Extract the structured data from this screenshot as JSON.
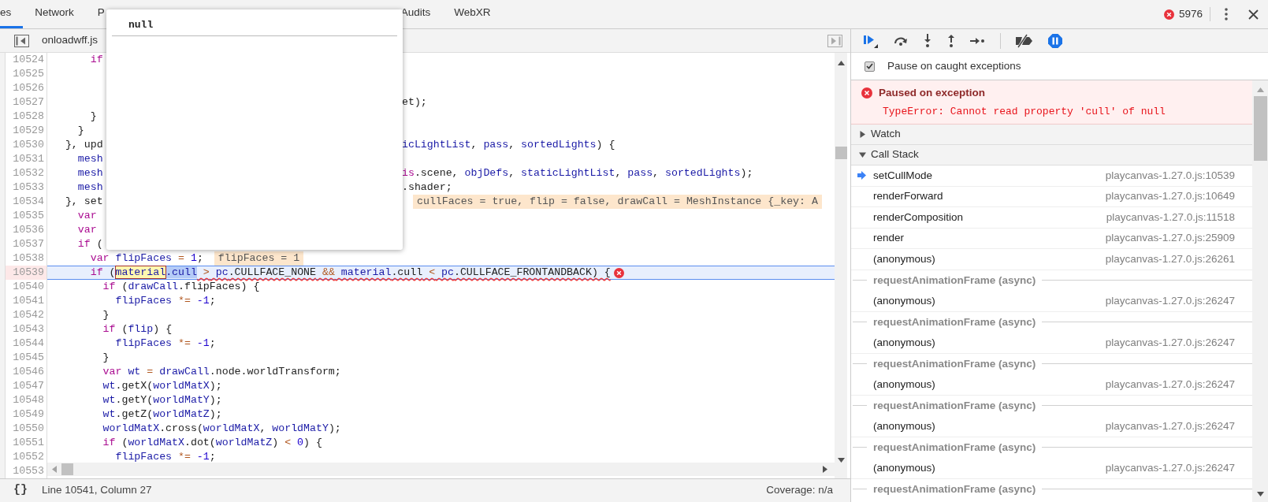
{
  "tabs": [
    {
      "label": "es",
      "selected": true
    },
    {
      "label": "Network",
      "selected": false
    },
    {
      "label": "P",
      "selected": false
    },
    {
      "label": "Audits",
      "selected": false
    },
    {
      "label": "WebXR",
      "selected": false
    }
  ],
  "error_count": "5976",
  "editor": {
    "file_tab": "onloadwff.js",
    "popover": {
      "value": "null"
    },
    "lines": [
      {
        "number": "10524",
        "paused": false,
        "tokens": [
          {
            "kw": "      if"
          }
        ]
      },
      {
        "number": "10525",
        "paused": false
      },
      {
        "number": "10526",
        "paused": false
      },
      {
        "number": "10527",
        "paused": false,
        "right": [
          {
            "plain": "et);"
          }
        ]
      },
      {
        "number": "10528",
        "paused": false,
        "tokens": [
          {
            "plain": "      }"
          }
        ]
      },
      {
        "number": "10529",
        "paused": false,
        "tokens": [
          {
            "plain": "    }"
          }
        ]
      },
      {
        "number": "10530",
        "paused": false,
        "tokens": [
          {
            "plain": "  }, upd"
          }
        ],
        "right": [
          {
            "var": "icLightList"
          },
          {
            "plain": ", "
          },
          {
            "var": "pass"
          },
          {
            "plain": ", "
          },
          {
            "var": "sortedLights"
          },
          {
            "plain": ") {"
          }
        ]
      },
      {
        "number": "10531",
        "paused": false,
        "tokens": [
          {
            "var": "    mesh"
          }
        ]
      },
      {
        "number": "10532",
        "paused": false,
        "tokens": [
          {
            "var": "    mesh"
          }
        ],
        "right": [
          {
            "kw": "is"
          },
          {
            "plain": ".scene, "
          },
          {
            "var": "objDefs"
          },
          {
            "plain": ", "
          },
          {
            "var": "staticLightList"
          },
          {
            "plain": ", "
          },
          {
            "var": "pass"
          },
          {
            "plain": ", "
          },
          {
            "var": "sortedLights"
          },
          {
            "plain": ");"
          }
        ]
      },
      {
        "number": "10533",
        "paused": false,
        "tokens": [
          {
            "var": "    mesh"
          }
        ],
        "right": [
          {
            "plain": ".shader;"
          }
        ]
      },
      {
        "number": "10534",
        "paused": false,
        "tokens": [
          {
            "plain": "  }, set"
          }
        ],
        "right": [
          {
            "inline": "cullFaces = true, flip = false, drawCall = MeshInstance {_key: A"
          }
        ]
      },
      {
        "number": "10535",
        "paused": false,
        "tokens": [
          {
            "kw": "    var"
          }
        ]
      },
      {
        "number": "10536",
        "paused": false,
        "tokens": [
          {
            "kw": "    var"
          }
        ]
      },
      {
        "number": "10537",
        "paused": false,
        "tokens": [
          {
            "kw": "    if"
          },
          {
            "plain": " ("
          }
        ]
      },
      {
        "number": "10538",
        "paused": false,
        "tokens": [
          {
            "kw": "      var"
          },
          {
            "var": " flipFaces"
          },
          {
            "op": " ="
          },
          {
            "num": " 1"
          },
          {
            "plain": ";"
          },
          {
            "inline": "flipFaces = 1"
          }
        ]
      },
      {
        "number": "10539",
        "paused": true,
        "tokens": [
          {
            "kw": "      if"
          },
          {
            "plain": " ("
          },
          {
            "hover": "material"
          },
          {
            "sel": ".cull"
          }
        ],
        "error_tokens": [
          {
            "op": " >"
          },
          {
            "var": " pc"
          },
          {
            "plain": ".CULLFACE_NONE"
          },
          {
            "op": " &&"
          },
          {
            "var": " material"
          },
          {
            "plain": ".cull"
          },
          {
            "op": " <"
          },
          {
            "var": " pc"
          },
          {
            "plain": ".CULLFACE_FRONTANDBACK) {"
          }
        ]
      },
      {
        "number": "10540",
        "paused": false,
        "tokens": [
          {
            "kw": "        if"
          },
          {
            "plain": " ("
          },
          {
            "var": "drawCall"
          },
          {
            "plain": ".flipFaces) {"
          }
        ]
      },
      {
        "number": "10541",
        "paused": false,
        "tokens": [
          {
            "var": "          flipFaces"
          },
          {
            "op": " *="
          },
          {
            "num": " -1"
          },
          {
            "plain": ";"
          }
        ]
      },
      {
        "number": "10542",
        "paused": false,
        "tokens": [
          {
            "plain": "        }"
          }
        ]
      },
      {
        "number": "10543",
        "paused": false,
        "tokens": [
          {
            "kw": "        if"
          },
          {
            "plain": " ("
          },
          {
            "var": "flip"
          },
          {
            "plain": ") {"
          }
        ]
      },
      {
        "number": "10544",
        "paused": false,
        "tokens": [
          {
            "var": "          flipFaces"
          },
          {
            "op": " *="
          },
          {
            "num": " -1"
          },
          {
            "plain": ";"
          }
        ]
      },
      {
        "number": "10545",
        "paused": false,
        "tokens": [
          {
            "plain": "        }"
          }
        ]
      },
      {
        "number": "10546",
        "paused": false,
        "tokens": [
          {
            "kw": "        var"
          },
          {
            "var": " wt"
          },
          {
            "op": " ="
          },
          {
            "var": " drawCall"
          },
          {
            "plain": ".node.worldTransform;"
          }
        ]
      },
      {
        "number": "10547",
        "paused": false,
        "tokens": [
          {
            "var": "        wt"
          },
          {
            "plain": ".getX("
          },
          {
            "var": "worldMatX"
          },
          {
            "plain": ");"
          }
        ]
      },
      {
        "number": "10548",
        "paused": false,
        "tokens": [
          {
            "var": "        wt"
          },
          {
            "plain": ".getY("
          },
          {
            "var": "worldMatY"
          },
          {
            "plain": ");"
          }
        ]
      },
      {
        "number": "10549",
        "paused": false,
        "tokens": [
          {
            "var": "        wt"
          },
          {
            "plain": ".getZ("
          },
          {
            "var": "worldMatZ"
          },
          {
            "plain": ");"
          }
        ]
      },
      {
        "number": "10550",
        "paused": false,
        "tokens": [
          {
            "var": "        worldMatX"
          },
          {
            "plain": ".cross("
          },
          {
            "var": "worldMatX"
          },
          {
            "plain": ", "
          },
          {
            "var": "worldMatY"
          },
          {
            "plain": ");"
          }
        ]
      },
      {
        "number": "10551",
        "paused": false,
        "tokens": [
          {
            "kw": "        if"
          },
          {
            "plain": " ("
          },
          {
            "var": "worldMatX"
          },
          {
            "plain": ".dot("
          },
          {
            "var": "worldMatZ"
          },
          {
            "plain": ")"
          },
          {
            "op": " <"
          },
          {
            "num": " 0"
          },
          {
            "plain": ") {"
          }
        ]
      },
      {
        "number": "10552",
        "paused": false,
        "tokens": [
          {
            "var": "          flipFaces"
          },
          {
            "op": " *="
          },
          {
            "num": " -1"
          },
          {
            "plain": ";"
          }
        ]
      },
      {
        "number": "10553",
        "paused": false
      }
    ]
  },
  "status": {
    "pretty_print": "{}",
    "position": "Line 10541, Column 27",
    "coverage": "Coverage: n/a"
  },
  "debugger": {
    "pause_on_caught": {
      "label": "Pause on caught exceptions",
      "checked": true
    },
    "exception": {
      "title": "Paused on exception",
      "message": "TypeError: Cannot read property 'cull' of null"
    },
    "sections": [
      {
        "label": "Watch",
        "expanded": false
      },
      {
        "label": "Call Stack",
        "expanded": true
      }
    ],
    "frames": [
      {
        "kind": "frame",
        "name": "setCullMode",
        "location": "playcanvas-1.27.0.js:10539",
        "selected": true
      },
      {
        "kind": "frame",
        "name": "renderForward",
        "location": "playcanvas-1.27.0.js:10649",
        "selected": false
      },
      {
        "kind": "frame",
        "name": "renderComposition",
        "location": "playcanvas-1.27.0.js:11518",
        "selected": false
      },
      {
        "kind": "frame",
        "name": "render",
        "location": "playcanvas-1.27.0.js:25909",
        "selected": false
      },
      {
        "kind": "frame",
        "name": "(anonymous)",
        "location": "playcanvas-1.27.0.js:26261",
        "selected": false
      },
      {
        "kind": "async",
        "label": "requestAnimationFrame (async)"
      },
      {
        "kind": "frame",
        "name": "(anonymous)",
        "location": "playcanvas-1.27.0.js:26247",
        "selected": false
      },
      {
        "kind": "async",
        "label": "requestAnimationFrame (async)"
      },
      {
        "kind": "frame",
        "name": "(anonymous)",
        "location": "playcanvas-1.27.0.js:26247",
        "selected": false
      },
      {
        "kind": "async",
        "label": "requestAnimationFrame (async)"
      },
      {
        "kind": "frame",
        "name": "(anonymous)",
        "location": "playcanvas-1.27.0.js:26247",
        "selected": false
      },
      {
        "kind": "async",
        "label": "requestAnimationFrame (async)"
      },
      {
        "kind": "frame",
        "name": "(anonymous)",
        "location": "playcanvas-1.27.0.js:26247",
        "selected": false
      },
      {
        "kind": "async",
        "label": "requestAnimationFrame (async)"
      },
      {
        "kind": "frame",
        "name": "(anonymous)",
        "location": "playcanvas-1.27.0.js:26247",
        "selected": false
      },
      {
        "kind": "async",
        "label": "requestAnimationFrame (async)"
      }
    ]
  }
}
